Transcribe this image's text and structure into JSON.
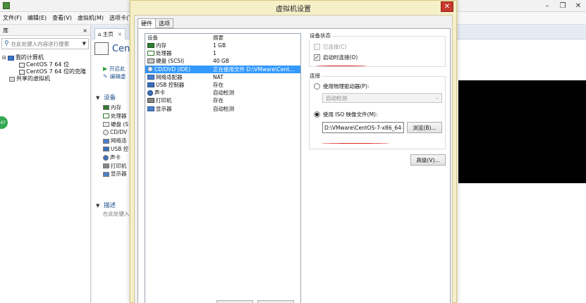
{
  "main_window": {
    "menu": [
      "文件(F)",
      "编辑(E)",
      "查看(V)",
      "虚拟机(M)",
      "选项卡(T)"
    ],
    "window_buttons": [
      "–",
      "❐",
      "✕"
    ],
    "library": {
      "title": "库",
      "close": "×",
      "search_placeholder": "在此处键入内容进行搜索",
      "tree": {
        "root": "我的计算机",
        "vms": [
          "CentOS 7 64 位",
          "CentOS 7 64 位的克隆"
        ],
        "shared": "共享的虚拟机"
      }
    },
    "badge": "47",
    "tabs": {
      "home": "主页",
      "close": "×"
    },
    "vm_panel": {
      "name": "Cen",
      "actions": [
        "开启此",
        "编辑虚"
      ],
      "devices_section": "设备",
      "devices": [
        "内存",
        "处理器",
        "硬盘 (S",
        "CD/DV",
        "网络适",
        "USB 控",
        "声卡",
        "打印机",
        "显示器"
      ],
      "description_section": "描述",
      "description_hint": "在此处键入"
    }
  },
  "dialog": {
    "title": "虚拟机设置",
    "close": "✕",
    "tabs": [
      "硬件",
      "选项"
    ],
    "active_tab": "硬件",
    "table_headers": {
      "device": "设备",
      "summary": "摘要"
    },
    "devices": [
      {
        "icon": "memory",
        "name": "内存",
        "summary": "1 GB"
      },
      {
        "icon": "cpu",
        "name": "处理器",
        "summary": "1"
      },
      {
        "icon": "disk",
        "name": "硬盘 (SCSI)",
        "summary": "40 GB"
      },
      {
        "icon": "cd",
        "name": "CD/DVD (IDE)",
        "summary": "正在使用文件 D:\\VMware\\Cent..."
      },
      {
        "icon": "network",
        "name": "网络适配器",
        "summary": "NAT"
      },
      {
        "icon": "usb",
        "name": "USB 控制器",
        "summary": "存在"
      },
      {
        "icon": "sound",
        "name": "声卡",
        "summary": "自动检测"
      },
      {
        "icon": "printer",
        "name": "打印机",
        "summary": "存在"
      },
      {
        "icon": "display",
        "name": "显示器",
        "summary": "自动检测"
      }
    ],
    "selected_index": 3,
    "device_status": {
      "title": "设备状态",
      "connected_label": "已连接(C)",
      "connected_checked": false,
      "connected_enabled": false,
      "connect_on_start_label": "启动时连接(O)",
      "connect_on_start_checked": true
    },
    "connection": {
      "title": "连接",
      "physical_label": "使用物理驱动器(P):",
      "physical_value": "自动检测",
      "iso_label": "使用 ISO 映像文件(M):",
      "iso_value": "D:\\VMware\\CentOS-7-x86_64",
      "browse_label": "浏览(B)...",
      "selected": "iso"
    },
    "advanced_label": "高级(V)..."
  },
  "colors": {
    "selection": "#3399ff",
    "dialog_frame": "#f6f0c8",
    "close_red": "#c7382c",
    "annotation_red": "#dd2222"
  }
}
